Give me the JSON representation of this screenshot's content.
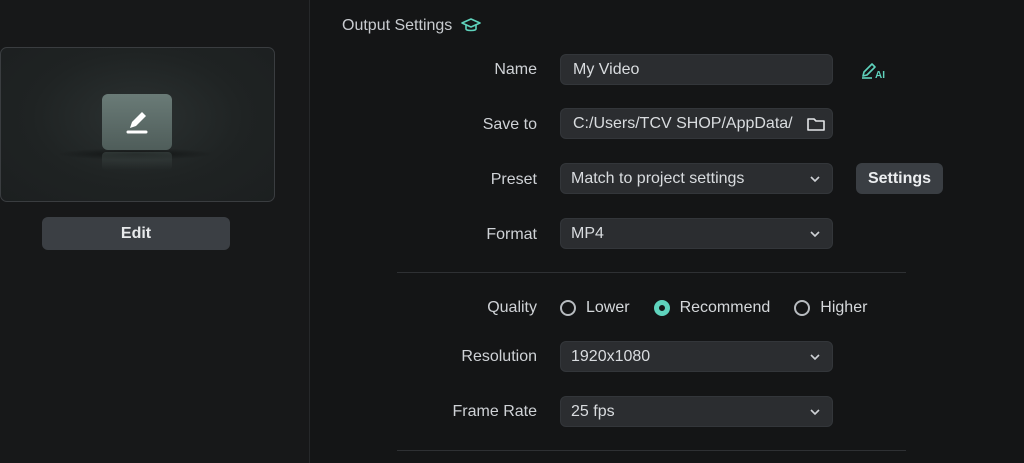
{
  "preview": {
    "edit_label": "Edit"
  },
  "output": {
    "title": "Output Settings",
    "name_label": "Name",
    "name_value": "My Video",
    "save_to_label": "Save to",
    "save_to_value": "C:/Users/TCV SHOP/AppData/",
    "preset_label": "Preset",
    "preset_value": "Match to project settings",
    "settings_label": "Settings",
    "format_label": "Format",
    "format_value": "MP4",
    "quality_label": "Quality",
    "quality_options": [
      "Lower",
      "Recommend",
      "Higher"
    ],
    "quality_selected": "Recommend",
    "resolution_label": "Resolution",
    "resolution_value": "1920x1080",
    "frame_rate_label": "Frame Rate",
    "frame_rate_value": "25 fps"
  },
  "icons": {
    "title_icon": "graduation-cap-icon",
    "ai_icon": "ai-edit-icon",
    "folder_icon": "folder-icon",
    "chevron_icon": "chevron-down-icon"
  },
  "colors": {
    "accent": "#5fd3bd",
    "background": "#141516",
    "field": "#2b2d30"
  }
}
